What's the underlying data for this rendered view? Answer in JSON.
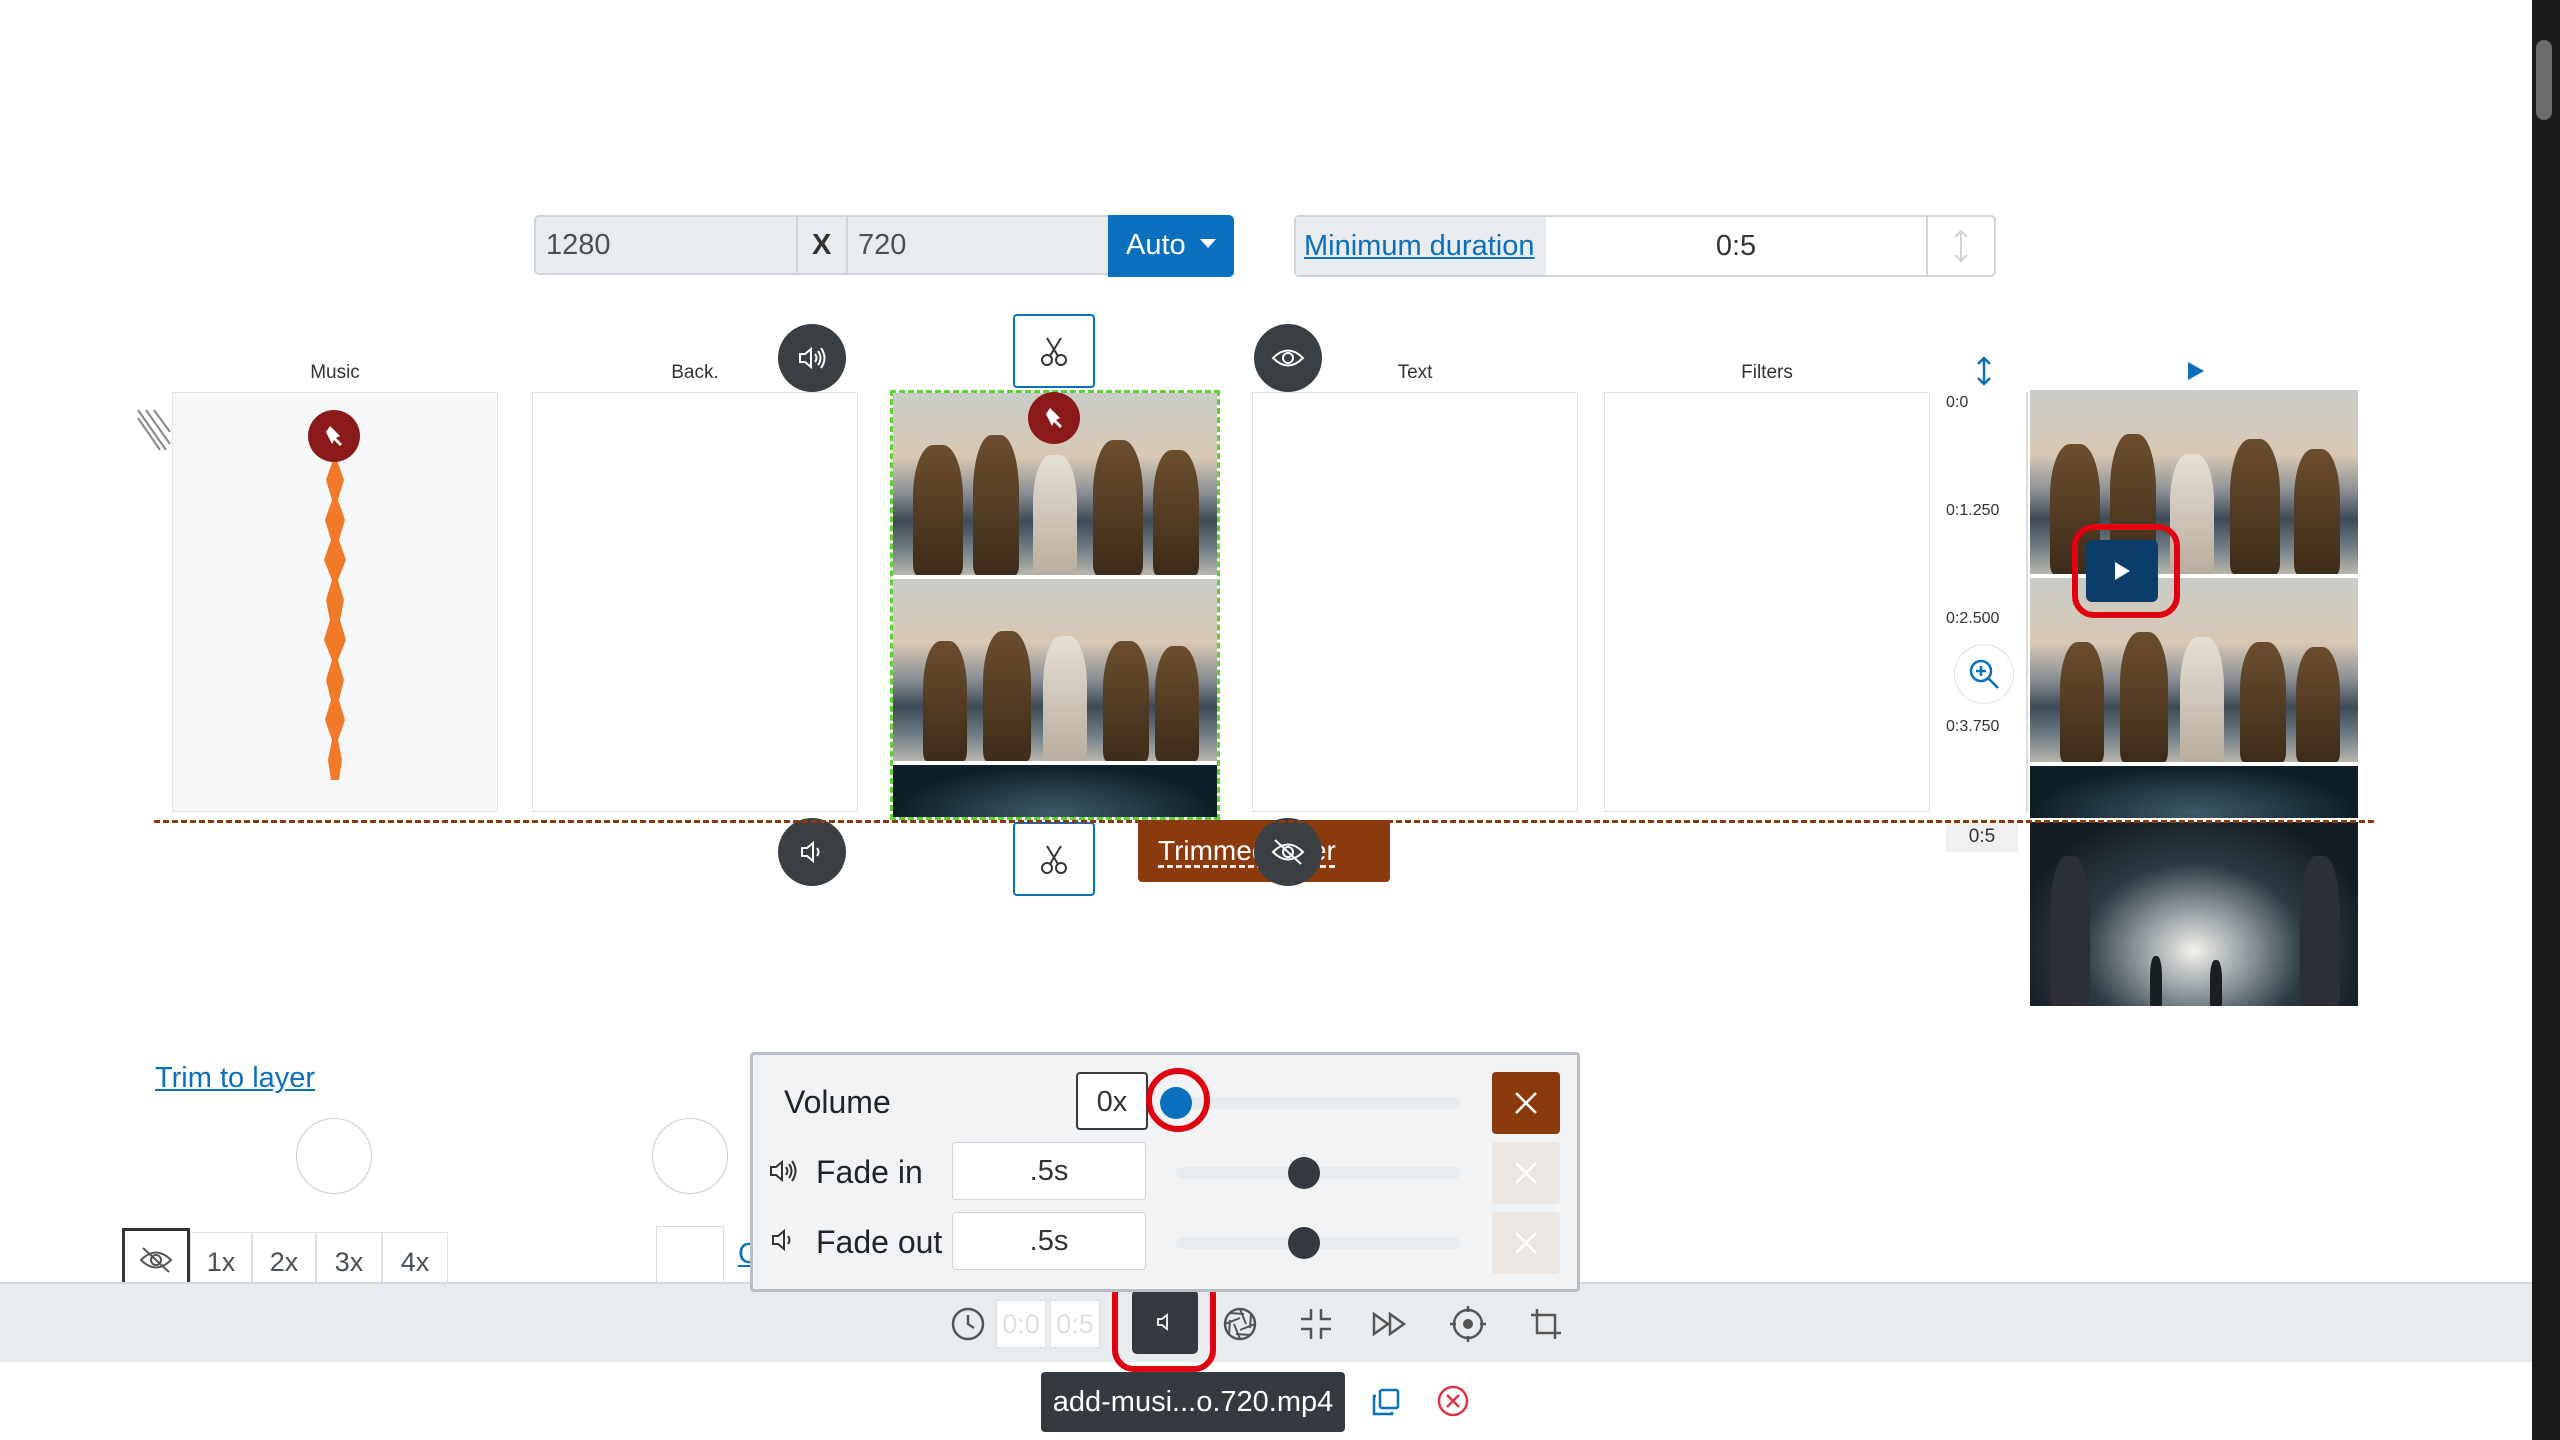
{
  "dims": {
    "width": "1280",
    "x_label": "X",
    "height": "720",
    "auto_label": "Auto"
  },
  "duration": {
    "label": "Minimum duration",
    "value": "0:5"
  },
  "columns": {
    "music": "Music",
    "back": "Back.",
    "text": "Text",
    "filters": "Filters"
  },
  "timeline": {
    "ticks": [
      "0:0",
      "0:1.250",
      "0:2.500",
      "0:3.750"
    ],
    "end": "0:5"
  },
  "trimmed_badge": "Trimmed layer",
  "trim_to_layer": "Trim to layer",
  "rates": [
    "1x",
    "2x",
    "3x",
    "4x"
  ],
  "partial_link": "C",
  "popup": {
    "volume_label": "Volume",
    "volume_value": "0x",
    "fade_in_label": "Fade in",
    "fade_in_value": ".5s",
    "fade_out_label": "Fade out",
    "fade_out_value": ".5s",
    "volume_level": 0,
    "fade_in_level": 0.45,
    "fade_out_level": 0.45
  },
  "toolbar": {
    "time_start": "0:0",
    "time_end": "0:5"
  },
  "file": {
    "name": "add-musi...o.720.mp4"
  },
  "colors": {
    "accent": "#0a6fbd",
    "brown": "#8b3a0e",
    "highlight": "#e0000f",
    "waveform": "#f07a28",
    "dark": "#3a3f44"
  },
  "icons": [
    "speaker-icon",
    "scissors-icon",
    "eye-icon",
    "eye-slash-icon",
    "pin-icon",
    "play-icon",
    "zoom-in-icon",
    "clock-icon",
    "speaker-low-icon",
    "aperture-icon",
    "compress-icon",
    "fast-forward-icon",
    "target-icon",
    "crop-icon",
    "copy-icon",
    "remove-icon",
    "resize-vertical-icon"
  ]
}
